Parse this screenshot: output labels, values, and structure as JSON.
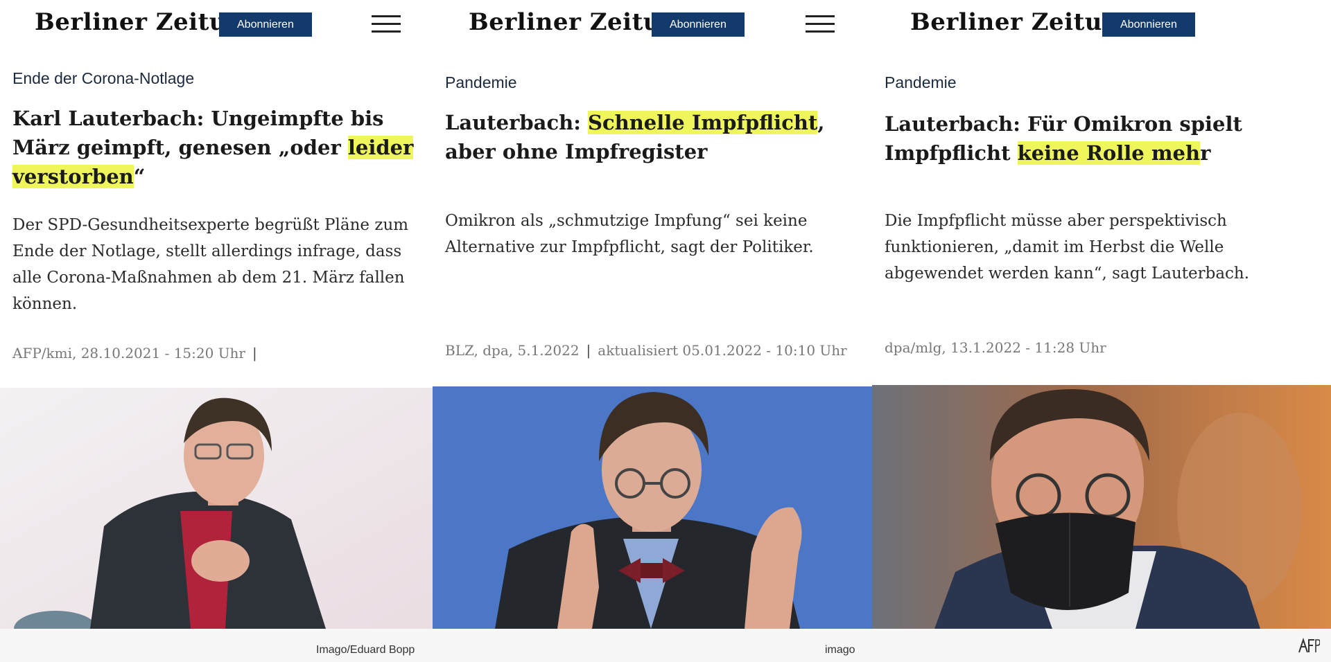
{
  "brand": "Berliner Zeitung",
  "subscribe_label": "Abonnieren",
  "articles": [
    {
      "category": "Ende der Corona-Notlage",
      "headline_parts": [
        "Karl Lauterbach: Ungeimpfte bis März geimpft, genesen „oder ",
        "leider verstorben",
        "“"
      ],
      "teaser": "Der SPD-Gesundheitsexperte begrüßt Pläne zum Ende der Notlage, stellt allerdings infrage, dass alle Corona-Maßnahmen ab dem 21. März fallen können.",
      "meta": "AFP/kmi, 28.10.2021 - 15:20 Uhr",
      "meta_sep": "|",
      "photo_credit": "Imago/Eduard Bopp"
    },
    {
      "category": "Pandemie",
      "headline_parts": [
        "Lauterbach: ",
        "Schnelle Impfpflicht",
        ", aber ohne Impfregister"
      ],
      "teaser": "Omikron als „schmutzige Impfung“ sei keine Alternative zur Impfpflicht, sagt der Politiker.",
      "meta": "BLZ, dpa, 5.1.2022",
      "meta_sep": "|",
      "meta_updated": "aktualisiert 05.01.2022 - 10:10 Uhr",
      "photo_credit": "imago"
    },
    {
      "category": "Pandemie",
      "headline_parts": [
        "Lauterbach: Für Omikron spielt Impfpflicht ",
        "keine Rolle meh",
        "r"
      ],
      "teaser": "Die Impfpflicht müsse aber perspektivisch funktionieren, „damit im Herbst die Welle abgewendet werden kann“, sagt Lauterbach.",
      "meta": "dpa/mlg, 13.1.2022 - 11:28 Uhr"
    }
  ],
  "watermark_logo": "AFP",
  "colors": {
    "subscribe_bg": "#123a6b",
    "highlight": "#eef65c",
    "meta_text": "#777777"
  },
  "icons": [
    "hamburger-menu-icon",
    "afp-logo-icon"
  ]
}
